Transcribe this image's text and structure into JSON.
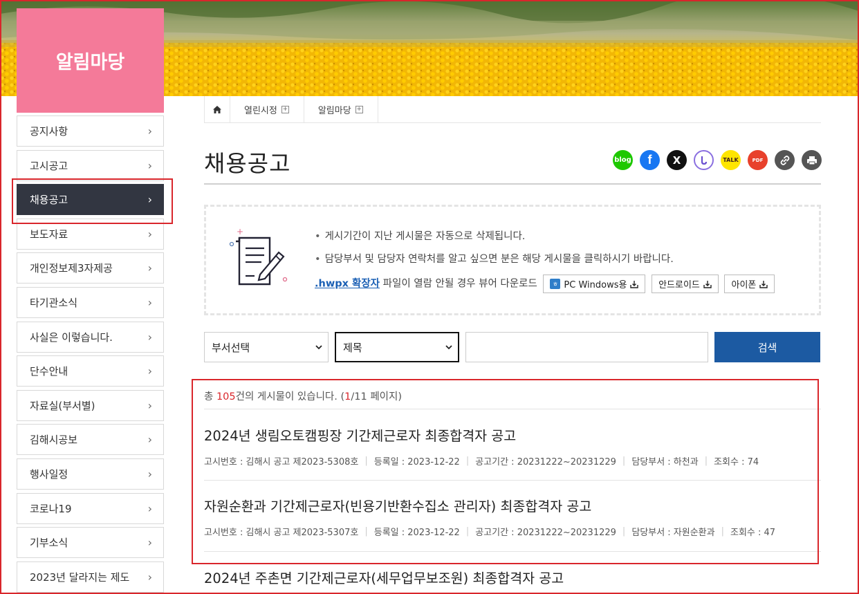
{
  "sidebar": {
    "title": "알림마당",
    "items": [
      {
        "label": "공지사항"
      },
      {
        "label": "고시공고"
      },
      {
        "label": "채용공고",
        "active": true
      },
      {
        "label": "보도자료"
      },
      {
        "label": "개인정보제3자제공"
      },
      {
        "label": "타기관소식"
      },
      {
        "label": "사실은 이렇습니다."
      },
      {
        "label": "단수안내"
      },
      {
        "label": "자료실(부서별)"
      },
      {
        "label": "김해시공보"
      },
      {
        "label": "행사일정"
      },
      {
        "label": "코로나19"
      },
      {
        "label": "기부소식"
      },
      {
        "label": "2023년 달라지는 제도"
      }
    ]
  },
  "breadcrumb": {
    "items": [
      {
        "label": "열린시정"
      },
      {
        "label": "알림마당"
      }
    ]
  },
  "page": {
    "title": "채용공고"
  },
  "share": [
    {
      "icon": "blog-icon",
      "label": "blog",
      "color": "#1ec800"
    },
    {
      "icon": "facebook-icon",
      "label": "f",
      "color": "#1877f2"
    },
    {
      "icon": "x-icon",
      "label": "X",
      "color": "#111111"
    },
    {
      "icon": "band-icon",
      "label": "",
      "color": "#ffffff"
    },
    {
      "icon": "kakaotalk-icon",
      "label": "TALK",
      "color": "#fee500"
    },
    {
      "icon": "pdf-icon",
      "label": "PDF",
      "color": "#e8412c"
    },
    {
      "icon": "link-icon",
      "label": "",
      "color": "#555555"
    },
    {
      "icon": "print-icon",
      "label": "",
      "color": "#555555"
    }
  ],
  "notice": {
    "line1": "게시기간이 지난 게시물은 자동으로 삭제됩니다.",
    "line2": "담당부서 및 담당자 연락처를 알고 싶으면 분은 해당 게시물을 클릭하시기 바랍니다.",
    "hwpx_link": ".hwpx 확장자",
    "hwpx_text": " 파일이 열람 안될 경우 뷰어 다운로드",
    "downloads": {
      "pc_badge": "ㅎ",
      "pc": "PC Windows용",
      "android": "안드로이드",
      "iphone": "아이폰"
    }
  },
  "search": {
    "dept_select": "부서선택",
    "field_select": "제목",
    "query": "",
    "button": "검색"
  },
  "summary": {
    "prefix": "총 ",
    "total": "105",
    "middle": "건의 게시물이 있습니다. (",
    "current_page": "1",
    "suffix": "/11 페이지)"
  },
  "posts": [
    {
      "title": "2024년 생림오토캠핑장 기간제근로자 최종합격자 공고",
      "notice_no": "고시번호 : 김해시 공고 제2023-5308호",
      "reg_date": "등록일 : 2023-12-22",
      "period": "공고기간 : 20231222~20231229",
      "dept": "담당부서 : 하천과",
      "views": "조회수 : 74"
    },
    {
      "title": "자원순환과 기간제근로자(빈용기반환수집소 관리자) 최종합격자 공고",
      "notice_no": "고시번호 : 김해시 공고 제2023-5307호",
      "reg_date": "등록일 : 2023-12-22",
      "period": "공고기간 : 20231222~20231229",
      "dept": "담당부서 : 자원순환과",
      "views": "조회수 : 47"
    },
    {
      "title": "2024년 주촌면 기간제근로자(세무업무보조원) 최종합격자 공고"
    }
  ]
}
